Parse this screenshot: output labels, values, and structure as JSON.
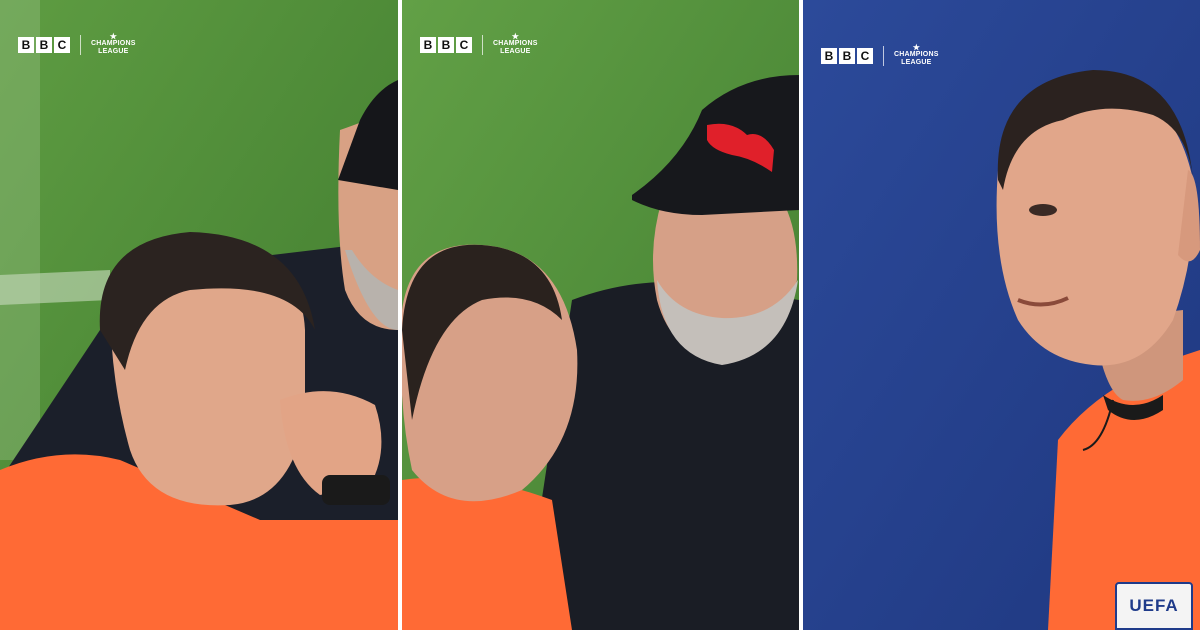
{
  "panels": [
    {
      "bbc_logo": [
        "B",
        "B",
        "C"
      ],
      "competition_logo": {
        "star_glyph": "★",
        "line1": "CHAMPIONS",
        "line2": "LEAGUE"
      }
    },
    {
      "bbc_logo": [
        "B",
        "B",
        "C"
      ],
      "competition_logo": {
        "star_glyph": "★",
        "line1": "CHAMPIONS",
        "line2": "LEAGUE"
      }
    },
    {
      "bbc_logo": [
        "B",
        "B",
        "C"
      ],
      "competition_logo": {
        "star_glyph": "★",
        "line1": "CHAMPIONS",
        "line2": "LEAGUE"
      },
      "sleeve_badge": "UEFA"
    }
  ],
  "colors": {
    "pitch": "#4f8f3a",
    "referee_kit": "#ff6a35",
    "backdrop_blue": "#26428f",
    "cap": "#17181c",
    "cap_logo": "#e0202a",
    "badge_border": "#1f3b8a"
  }
}
